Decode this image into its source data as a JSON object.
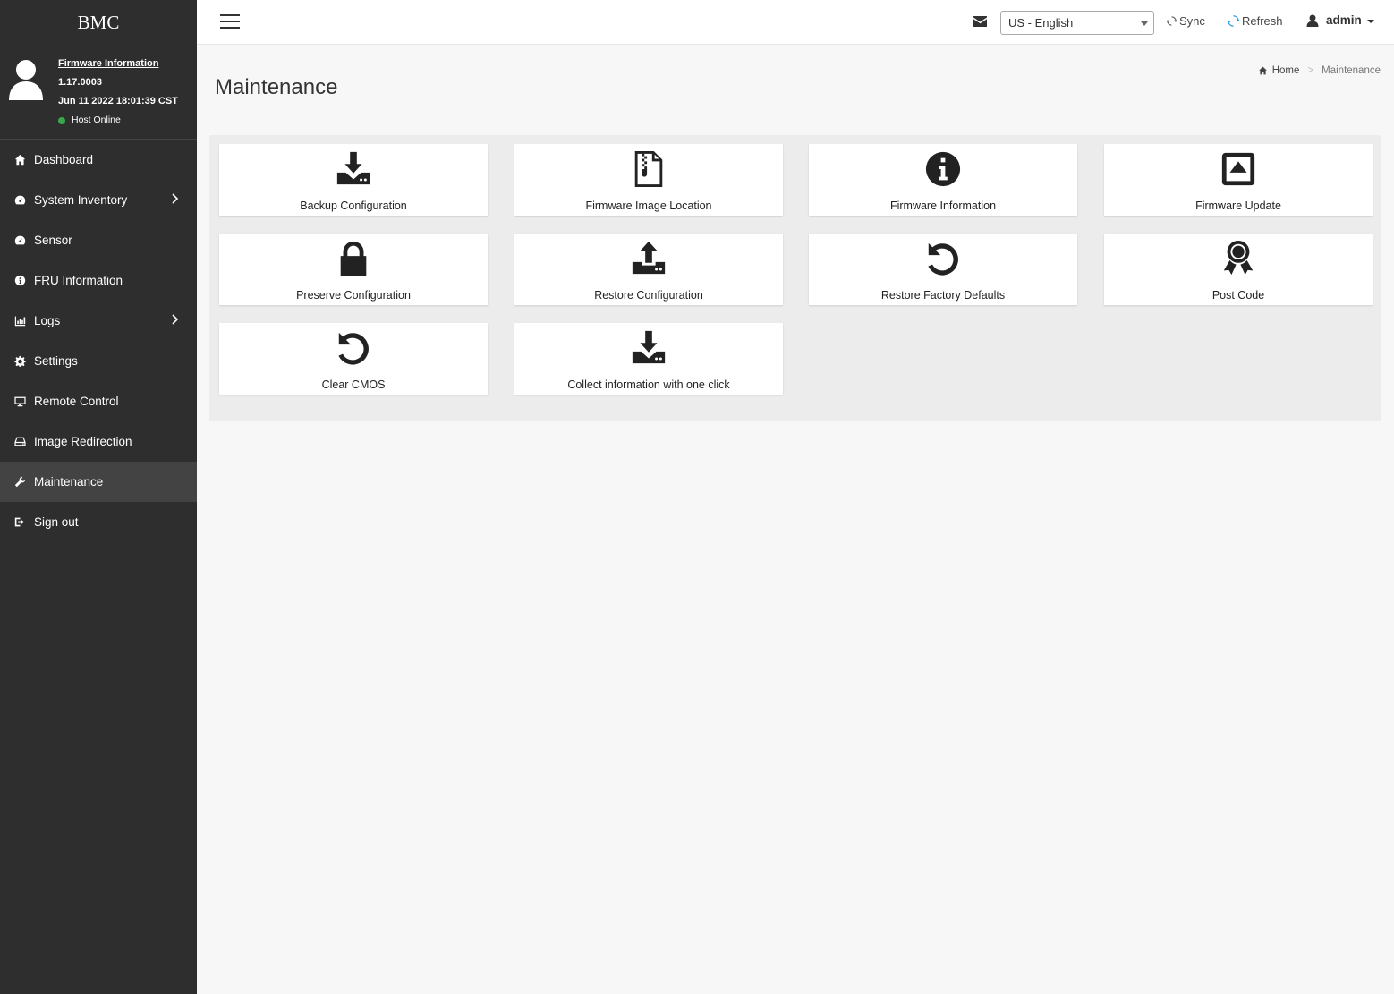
{
  "brand": "BMC",
  "user_panel": {
    "firmware_link": "Firmware Information",
    "version": "1.17.0003",
    "build_date": "Jun 11 2022 18:01:39 CST",
    "host_status": "Host Online",
    "host_status_color": "#3aa74a"
  },
  "sidebar": {
    "items": [
      {
        "label": "Dashboard",
        "icon": "home-icon"
      },
      {
        "label": "System Inventory",
        "icon": "dashboard-gauge-icon",
        "has_submenu": true
      },
      {
        "label": "Sensor",
        "icon": "dashboard-gauge-icon"
      },
      {
        "label": "FRU Information",
        "icon": "info-icon"
      },
      {
        "label": "Logs",
        "icon": "bar-chart-icon",
        "has_submenu": true
      },
      {
        "label": "Settings",
        "icon": "gear-icon"
      },
      {
        "label": "Remote Control",
        "icon": "monitor-icon"
      },
      {
        "label": "Image Redirection",
        "icon": "drive-icon"
      },
      {
        "label": "Maintenance",
        "icon": "wrench-icon",
        "active": true
      },
      {
        "label": "Sign out",
        "icon": "sign-out-icon"
      }
    ]
  },
  "topbar": {
    "language": "US - English",
    "sync_label": "Sync",
    "refresh_label": "Refresh",
    "username": "admin",
    "accent_color": "#1e9be0"
  },
  "page": {
    "title": "Maintenance",
    "breadcrumb_home": "Home",
    "breadcrumb_current": "Maintenance"
  },
  "tiles": [
    {
      "label": "Backup Configuration",
      "icon": "download-icon"
    },
    {
      "label": "Firmware Image Location",
      "icon": "file-zip-icon"
    },
    {
      "label": "Firmware Information",
      "icon": "info-circle-icon"
    },
    {
      "label": "Firmware Update",
      "icon": "eject-square-icon"
    },
    {
      "label": "Preserve Configuration",
      "icon": "lock-icon"
    },
    {
      "label": "Restore Configuration",
      "icon": "upload-icon"
    },
    {
      "label": "Restore Factory Defaults",
      "icon": "undo-icon"
    },
    {
      "label": "Post Code",
      "icon": "award-ribbon-icon"
    },
    {
      "label": "Clear CMOS",
      "icon": "undo-icon"
    },
    {
      "label": "Collect information with one click",
      "icon": "download-icon"
    }
  ]
}
